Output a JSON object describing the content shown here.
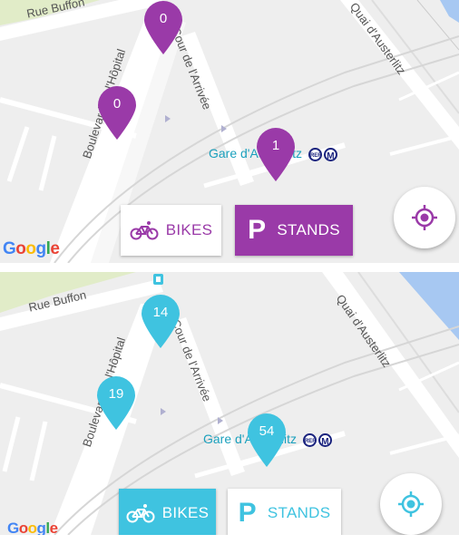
{
  "colors": {
    "purple": "#9a3aa8",
    "cyan": "#3fc3e0",
    "map_bg": "#eeeeee",
    "road": "#ffffff",
    "green_area": "#e1ecc8",
    "water": "#a7c8f2"
  },
  "map_labels": {
    "rue_buffon": "Rue Buffon",
    "boulevard": "Boulevard de l'Hôpital",
    "cour": "Cour de l'Arrivée",
    "quai": "Quai d'Austerlitz",
    "gare": "Gare d'Austerlitz",
    "rer": "RER",
    "metro": "M"
  },
  "top_panel": {
    "mode": "stands",
    "pins": [
      {
        "count": "0"
      },
      {
        "count": "0"
      },
      {
        "count": "1"
      }
    ],
    "bikes_label": "BIKES",
    "stands_label": "STANDS"
  },
  "bottom_panel": {
    "mode": "bikes",
    "pins": [
      {
        "count": "14"
      },
      {
        "count": "19"
      },
      {
        "count": "54"
      }
    ],
    "bikes_label": "BIKES",
    "stands_label": "STANDS"
  },
  "google_logo": "Google",
  "icons": {
    "bike": "bicycle-icon",
    "parking": "parking-icon",
    "locate": "my-location-icon",
    "transit_entrance": "metro-entrance-icon"
  }
}
